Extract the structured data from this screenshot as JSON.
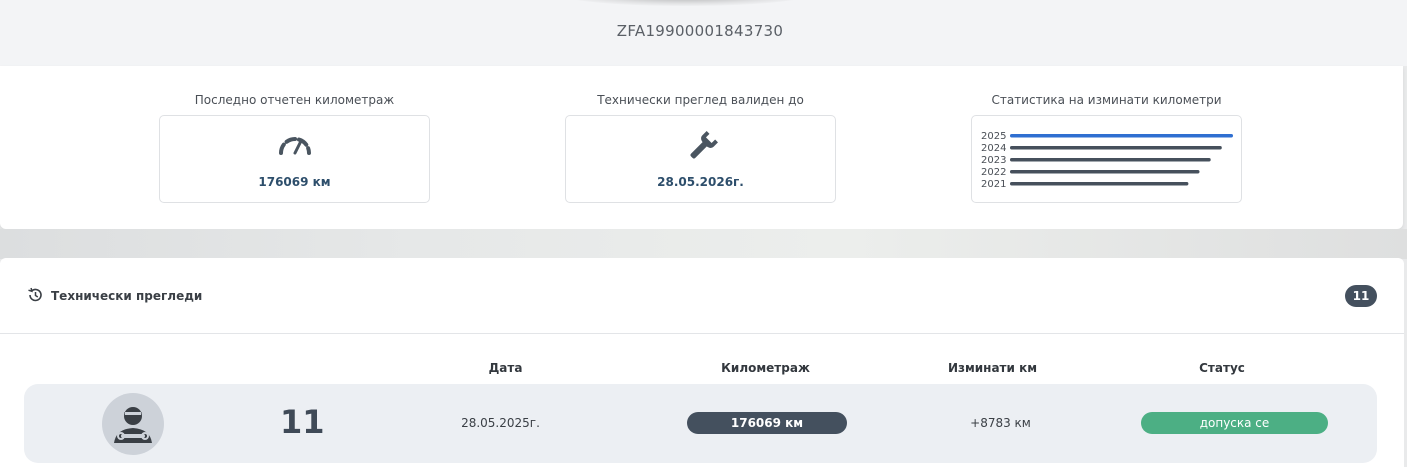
{
  "vehicle": {
    "vin": "ZFA19900001843730"
  },
  "stats": {
    "mileage": {
      "label": "Последно отчетен километраж",
      "value": "176069 км",
      "icon": "speedometer-icon"
    },
    "inspection_valid": {
      "label": "Технически преглед валиден до",
      "value": "28.05.2026г.",
      "icon": "wrench-icon"
    },
    "km_statistics": {
      "label": "Статистика на изминати километри"
    }
  },
  "chart_data": {
    "type": "bar",
    "orientation": "horizontal",
    "categories": [
      "2025",
      "2024",
      "2023",
      "2022",
      "2021"
    ],
    "values": [
      1.0,
      0.95,
      0.9,
      0.85,
      0.8
    ],
    "highlight_color": "#2f6fd1",
    "bar_color": "#46505c",
    "axes": false,
    "grid": false
  },
  "inspections": {
    "title": "Технически прегледи",
    "count": "11",
    "icon": "history-icon",
    "columns": {
      "date": "Дата",
      "mileage": "Километраж",
      "traveled": "Изминати км",
      "status": "Статус"
    },
    "rows": [
      {
        "number": "11",
        "date": "28.05.2025г.",
        "mileage": "176069 км",
        "traveled": "+8783 км",
        "status": "допуска се",
        "avatar": "mechanic-avatar-icon"
      }
    ]
  },
  "colors": {
    "accent_dark": "#44505e",
    "value_blue": "#2d4e6b",
    "status_green": "#4caf84"
  }
}
